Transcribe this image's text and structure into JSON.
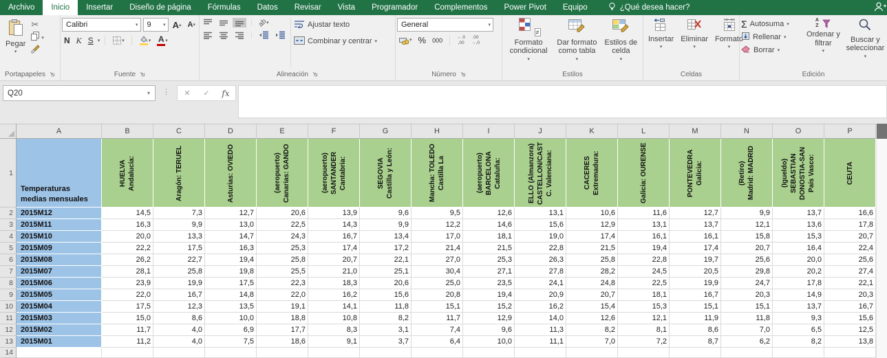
{
  "ribbon": {
    "tabs": [
      "Archivo",
      "Inicio",
      "Insertar",
      "Diseño de página",
      "Fórmulas",
      "Datos",
      "Revisar",
      "Vista",
      "Programador",
      "Complementos",
      "Power Pivot",
      "Equipo"
    ],
    "active_tab": "Inicio",
    "search_placeholder": "¿Qué desea hacer?",
    "clipboard": {
      "label": "Portapapeles",
      "paste": "Pegar"
    },
    "font": {
      "label": "Fuente",
      "name": "Calibri",
      "size": "9",
      "bold": "N",
      "italic": "K",
      "underline": "S",
      "grow": "A",
      "shrink": "A"
    },
    "alignment": {
      "label": "Alineación",
      "wrap_text": "Ajustar texto",
      "merge_center": "Combinar y centrar",
      "orientation_glyph": "ab"
    },
    "number": {
      "label": "Número",
      "format": "General",
      "percent": "%",
      "thousands": "000"
    },
    "styles": {
      "label": "Estilos",
      "conditional": "Formato condicional",
      "as_table": "Dar formato como tabla",
      "cell_styles": "Estilos de celda",
      "not_equal": "≠"
    },
    "cells": {
      "label": "Celdas",
      "insert": "Insertar",
      "delete": "Eliminar",
      "format": "Formato"
    },
    "editing": {
      "label": "Edición",
      "sigma": "Σ",
      "autosum": "Autosuma",
      "fill": "Rellenar",
      "clear": "Borrar",
      "sort": "Ordenar y filtrar",
      "find": "Buscar y seleccionar",
      "sort_a": "A",
      "sort_z": "Z"
    }
  },
  "formula_bar": {
    "name_box": "Q20",
    "cancel": "✕",
    "confirm": "✓",
    "fx": "fx"
  },
  "grid": {
    "corner_title": "Temperaturas medias mensuales",
    "column_letters": [
      "A",
      "B",
      "C",
      "D",
      "E",
      "F",
      "G",
      "H",
      "I",
      "J",
      "K",
      "L",
      "M",
      "N",
      "O",
      "P"
    ],
    "station_headers": [
      "Andalucía: HUELVA",
      "Aragón: TERUEL",
      "Asturias: OVIEDO",
      "Canarias: GANDO (aeropuerto)",
      "Cantabria: SANTANDER (aeropuerto)",
      "Castilla y León: SEGOVIA",
      "Castilla La Mancha: TOLEDO",
      "Cataluña: BARCELONA (aeropuerto)",
      "C. Valenciana: CASTELLON/CASTELLO (Almanzora)",
      "Extremadura: CACERES",
      "Galicia: OURENSE",
      "Galicia: PONTEVEDRA",
      "Madrid: MADRID (Retiro)",
      "País Vasco: DONOSTIA-SAN SEBASTIAN (Igueldo)",
      "CEUTA"
    ],
    "rows": [
      {
        "label": "2015M12",
        "values": [
          "14,5",
          "7,3",
          "12,7",
          "20,6",
          "13,9",
          "9,6",
          "9,5",
          "12,6",
          "13,1",
          "10,6",
          "11,6",
          "12,7",
          "9,9",
          "13,7",
          "16,6"
        ]
      },
      {
        "label": "2015M11",
        "values": [
          "16,3",
          "9,9",
          "13,0",
          "22,5",
          "14,3",
          "9,9",
          "12,2",
          "14,6",
          "15,6",
          "12,9",
          "13,1",
          "13,7",
          "12,1",
          "13,6",
          "17,8"
        ]
      },
      {
        "label": "2015M10",
        "values": [
          "20,0",
          "13,3",
          "14,7",
          "24,3",
          "16,7",
          "13,4",
          "17,0",
          "18,1",
          "19,0",
          "17,4",
          "16,1",
          "16,1",
          "15,8",
          "15,3",
          "20,7"
        ]
      },
      {
        "label": "2015M09",
        "values": [
          "22,2",
          "17,5",
          "16,3",
          "25,3",
          "17,4",
          "17,2",
          "21,4",
          "21,5",
          "22,8",
          "21,5",
          "19,4",
          "17,4",
          "20,7",
          "16,4",
          "22,4"
        ]
      },
      {
        "label": "2015M08",
        "values": [
          "26,2",
          "22,7",
          "19,4",
          "25,8",
          "20,7",
          "22,1",
          "27,0",
          "25,3",
          "26,3",
          "25,8",
          "22,8",
          "19,7",
          "25,6",
          "20,0",
          "25,6"
        ]
      },
      {
        "label": "2015M07",
        "values": [
          "28,1",
          "25,8",
          "19,8",
          "25,5",
          "21,0",
          "25,1",
          "30,4",
          "27,1",
          "27,8",
          "28,2",
          "24,5",
          "20,5",
          "29,8",
          "20,2",
          "27,4"
        ]
      },
      {
        "label": "2015M06",
        "values": [
          "23,9",
          "19,9",
          "17,5",
          "22,3",
          "18,3",
          "20,6",
          "25,0",
          "23,5",
          "24,1",
          "24,8",
          "22,5",
          "19,9",
          "24,7",
          "17,8",
          "22,1"
        ]
      },
      {
        "label": "2015M05",
        "values": [
          "22,0",
          "16,7",
          "14,8",
          "22,0",
          "16,2",
          "15,6",
          "20,8",
          "19,4",
          "20,9",
          "20,7",
          "18,1",
          "16,7",
          "20,3",
          "14,9",
          "20,3"
        ]
      },
      {
        "label": "2015M04",
        "values": [
          "17,5",
          "12,3",
          "13,5",
          "19,1",
          "14,1",
          "11,8",
          "15,1",
          "15,2",
          "16,2",
          "15,4",
          "15,3",
          "15,1",
          "15,1",
          "13,7",
          "16,7"
        ]
      },
      {
        "label": "2015M03",
        "values": [
          "15,0",
          "8,6",
          "10,0",
          "18,8",
          "10,8",
          "8,2",
          "11,7",
          "12,9",
          "14,0",
          "12,6",
          "12,1",
          "11,9",
          "11,8",
          "9,3",
          "15,6"
        ]
      },
      {
        "label": "2015M02",
        "values": [
          "11,7",
          "4,0",
          "6,9",
          "17,7",
          "8,3",
          "3,1",
          "7,4",
          "9,6",
          "11,3",
          "8,2",
          "8,1",
          "8,6",
          "7,0",
          "6,5",
          "12,5"
        ]
      },
      {
        "label": "2015M01",
        "values": [
          "11,2",
          "4,0",
          "7,5",
          "18,6",
          "9,1",
          "3,7",
          "6,4",
          "10,0",
          "11,1",
          "7,0",
          "7,2",
          "8,7",
          "6,2",
          "8,2",
          "13,8"
        ]
      }
    ],
    "empty_row_number": "14",
    "colors": {
      "header_green": "#A9D08E",
      "header_blue": "#9DC3E6",
      "tab_green": "#217346"
    }
  }
}
